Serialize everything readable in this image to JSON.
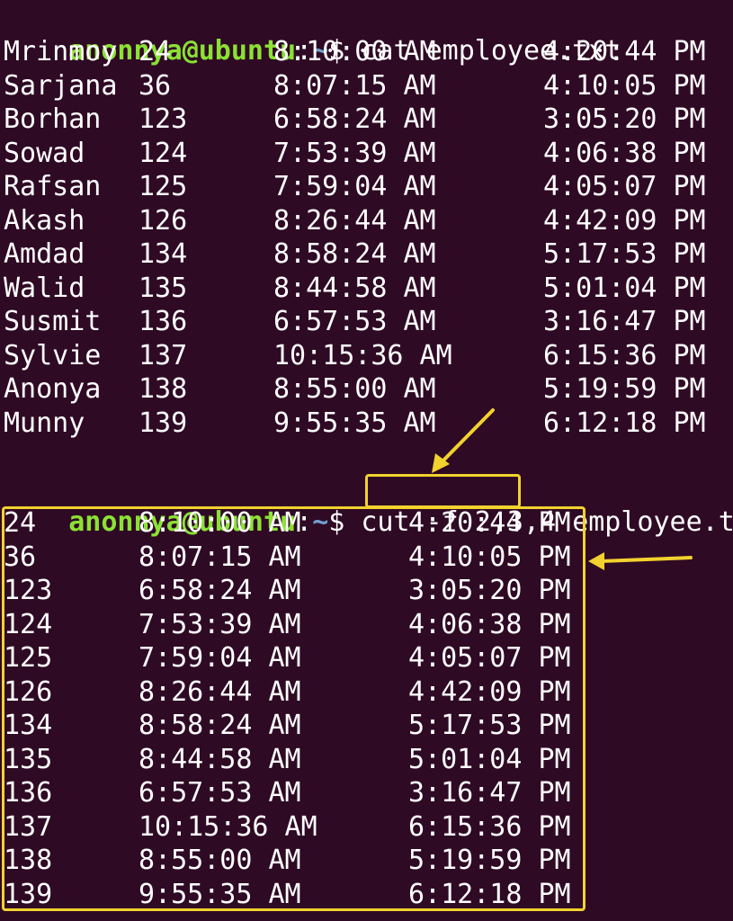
{
  "prompt": {
    "user_host": "anonnya@ubuntu",
    "colon": ":",
    "path": "~",
    "dollar": "$"
  },
  "commands": [
    {
      "cmd": "cat employee.txt",
      "args": ""
    },
    {
      "cmd": "cut",
      "highlight": "-f 2,3,4",
      "rest": "employee.txt"
    }
  ],
  "file_rows": [
    [
      "Mrinmoy",
      "24",
      "8:10:00 AM",
      "4:20:44 PM"
    ],
    [
      "Sarjana",
      "36",
      "8:07:15 AM",
      "4:10:05 PM"
    ],
    [
      "Borhan",
      "123",
      "6:58:24 AM",
      "3:05:20 PM"
    ],
    [
      "Sowad",
      "124",
      "7:53:39 AM",
      "4:06:38 PM"
    ],
    [
      "Rafsan",
      "125",
      "7:59:04 AM",
      "4:05:07 PM"
    ],
    [
      "Akash",
      "126",
      "8:26:44 AM",
      "4:42:09 PM"
    ],
    [
      "Amdad",
      "134",
      "8:58:24 AM",
      "5:17:53 PM"
    ],
    [
      "Walid",
      "135",
      "8:44:58 AM",
      "5:01:04 PM"
    ],
    [
      "Susmit",
      "136",
      "6:57:53 AM",
      "3:16:47 PM"
    ],
    [
      "Sylvie",
      "137",
      "10:15:36 AM",
      "6:15:36 PM"
    ],
    [
      "Anonya",
      "138",
      "8:55:00 AM",
      "5:19:59 PM"
    ],
    [
      "Munny",
      "139",
      "9:55:35 AM",
      "6:12:18 PM"
    ]
  ],
  "cut_rows": [
    [
      "24",
      "8:10:00 AM",
      "4:20:44 PM"
    ],
    [
      "36",
      "8:07:15 AM",
      "4:10:05 PM"
    ],
    [
      "123",
      "6:58:24 AM",
      "3:05:20 PM"
    ],
    [
      "124",
      "7:53:39 AM",
      "4:06:38 PM"
    ],
    [
      "125",
      "7:59:04 AM",
      "4:05:07 PM"
    ],
    [
      "126",
      "8:26:44 AM",
      "4:42:09 PM"
    ],
    [
      "134",
      "8:58:24 AM",
      "5:17:53 PM"
    ],
    [
      "135",
      "8:44:58 AM",
      "5:01:04 PM"
    ],
    [
      "136",
      "6:57:53 AM",
      "3:16:47 PM"
    ],
    [
      "137",
      "10:15:36 AM",
      "6:15:36 PM"
    ],
    [
      "138",
      "8:55:00 AM",
      "5:19:59 PM"
    ],
    [
      "139",
      "9:55:35 AM",
      "6:12:18 PM"
    ]
  ],
  "colors": {
    "background": "#2f0a24",
    "prompt_user": "#8ae234",
    "prompt_path": "#729fcf",
    "text": "#ffffff",
    "highlight": "#f2d22e"
  }
}
